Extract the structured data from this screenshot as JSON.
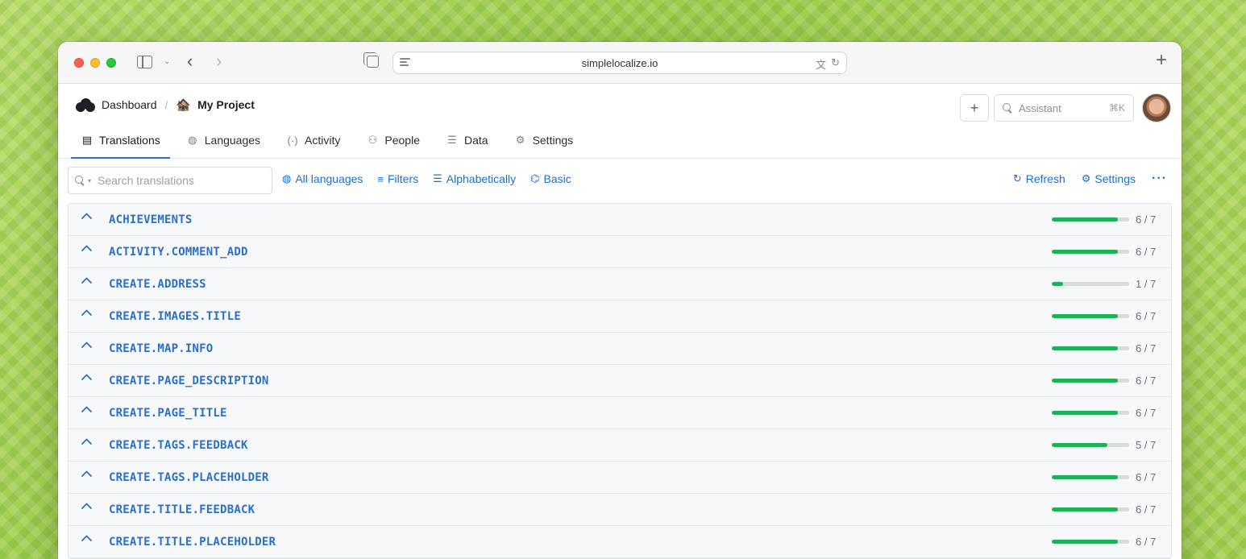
{
  "browser": {
    "url": "simplelocalize.io"
  },
  "breadcrumb": {
    "dashboard": "Dashboard",
    "separator": "/",
    "project_emoji": "🏚️",
    "project": "My Project"
  },
  "header": {
    "plus": "+",
    "assistant_placeholder": "Assistant",
    "assistant_shortcut": "⌘K"
  },
  "tabs": [
    {
      "label": "Translations",
      "icon": "id-card-icon"
    },
    {
      "label": "Languages",
      "icon": "globe-icon"
    },
    {
      "label": "Activity",
      "icon": "broadcast-icon"
    },
    {
      "label": "People",
      "icon": "people-icon"
    },
    {
      "label": "Data",
      "icon": "database-icon"
    },
    {
      "label": "Settings",
      "icon": "gear-icon"
    }
  ],
  "toolbar": {
    "search_placeholder": "Search translations",
    "all_languages": "All languages",
    "filters": "Filters",
    "sort": "Alphabetically",
    "view": "Basic",
    "refresh": "Refresh",
    "settings": "Settings",
    "more": "···"
  },
  "colors": {
    "accent": "#1d6fce",
    "progress": "#1bb157",
    "progress_track": "#d9dcdf"
  },
  "rows": [
    {
      "key": "ACHIEVEMENTS",
      "done": 6,
      "total": 7,
      "count": "6 / 7"
    },
    {
      "key": "ACTIVITY.COMMENT_ADD",
      "done": 6,
      "total": 7,
      "count": "6 / 7"
    },
    {
      "key": "CREATE.ADDRESS",
      "done": 1,
      "total": 7,
      "count": "1 / 7"
    },
    {
      "key": "CREATE.IMAGES.TITLE",
      "done": 6,
      "total": 7,
      "count": "6 / 7"
    },
    {
      "key": "CREATE.MAP.INFO",
      "done": 6,
      "total": 7,
      "count": "6 / 7"
    },
    {
      "key": "CREATE.PAGE_DESCRIPTION",
      "done": 6,
      "total": 7,
      "count": "6 / 7"
    },
    {
      "key": "CREATE.PAGE_TITLE",
      "done": 6,
      "total": 7,
      "count": "6 / 7"
    },
    {
      "key": "CREATE.TAGS.FEEDBACK",
      "done": 5,
      "total": 7,
      "count": "5 / 7"
    },
    {
      "key": "CREATE.TAGS.PLACEHOLDER",
      "done": 6,
      "total": 7,
      "count": "6 / 7"
    },
    {
      "key": "CREATE.TITLE.FEEDBACK",
      "done": 6,
      "total": 7,
      "count": "6 / 7"
    },
    {
      "key": "CREATE.TITLE.PLACEHOLDER",
      "done": 6,
      "total": 7,
      "count": "6 / 7"
    }
  ]
}
